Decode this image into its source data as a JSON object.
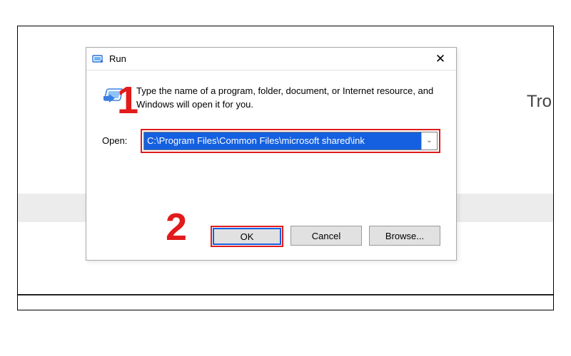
{
  "background": {
    "partial_text": "Tro"
  },
  "dialog": {
    "title": "Run",
    "close_symbol": "✕",
    "instruction": "Type the name of a program, folder, document, or Internet resource, and Windows will open it for you.",
    "open_label": "Open:",
    "open_value": "C:\\Program Files\\Common Files\\microsoft shared\\ink",
    "dropdown_arrow": "⌄"
  },
  "buttons": {
    "ok": "OK",
    "cancel": "Cancel",
    "browse": "Browse..."
  },
  "annotations": {
    "step1": "1",
    "step2": "2"
  }
}
